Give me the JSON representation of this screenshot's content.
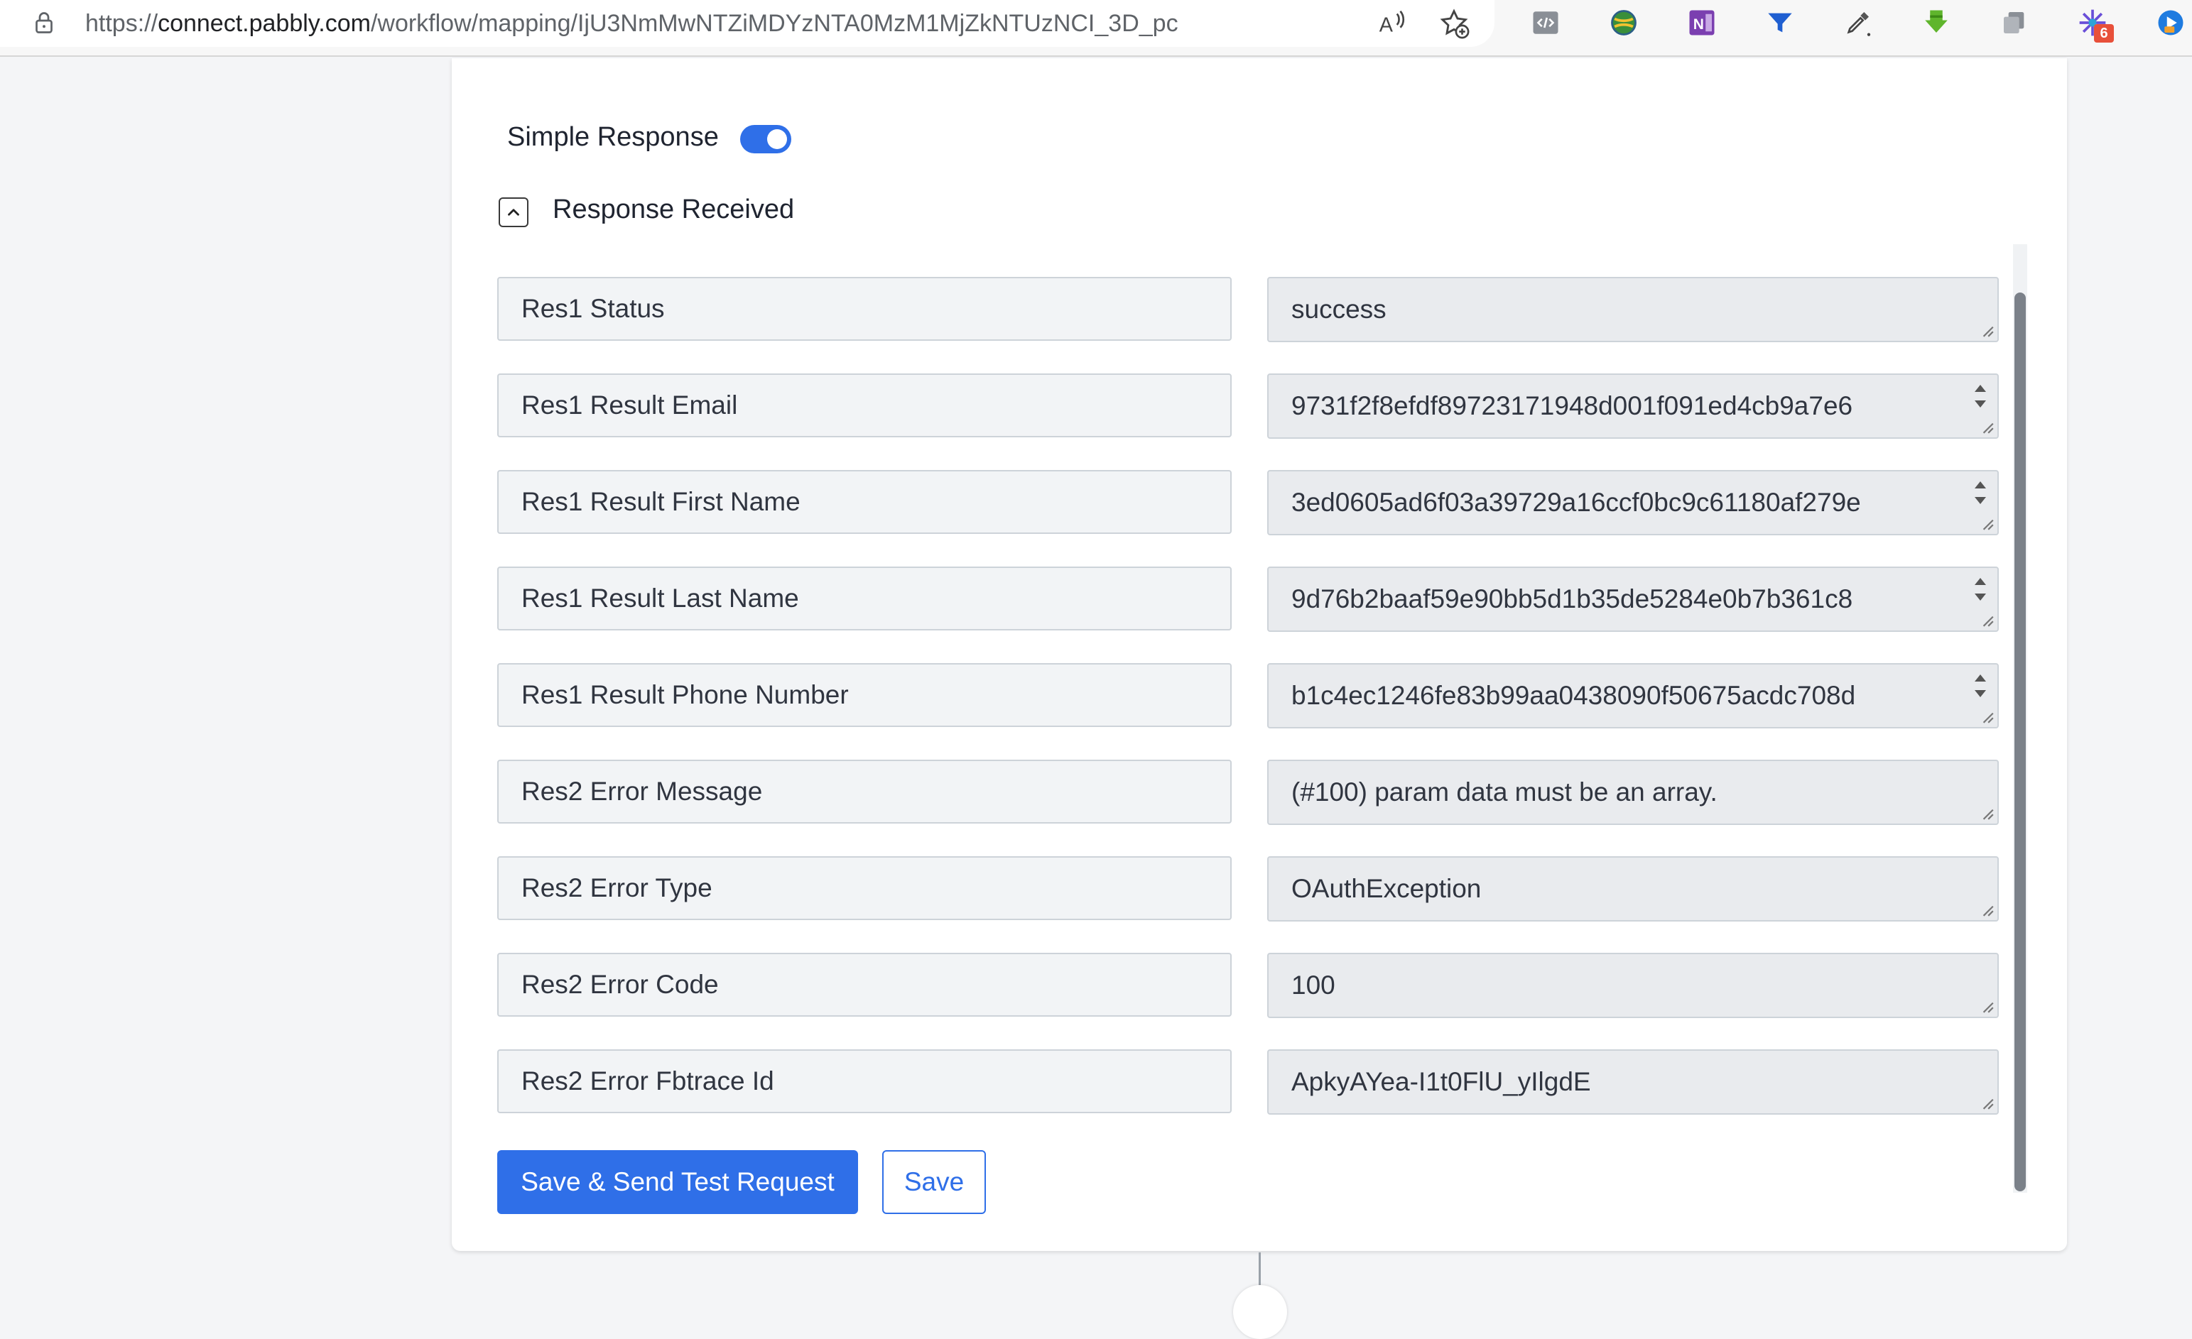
{
  "browser": {
    "url_prefix": "https://",
    "url_host": "connect.pabbly.com",
    "url_path": "/workflow/mapping/IjU3NmMwNTZiMDYzNTA0MzM1MjZkNTUzNCI_3D_pc",
    "extension_badge_count": "6",
    "icons": [
      "lock-icon",
      "read-aloud-icon",
      "add-favorite-icon",
      "dev-tools-icon",
      "globe-extension-icon",
      "onenote-icon",
      "funnel-extension-icon",
      "eyedropper-icon",
      "download-arrow-icon",
      "copy-extension-icon",
      "puzzle-spark-icon",
      "profile-extension-icon"
    ]
  },
  "form": {
    "simple_response_label": "Simple Response",
    "simple_response_on": true,
    "response_received_label": "Response Received",
    "rows": [
      {
        "label": "Res1 Status",
        "value": "success",
        "spinner": false
      },
      {
        "label": "Res1 Result Email",
        "value": "9731f2f8efdf89723171948d001f091ed4cb9a7e6",
        "spinner": true
      },
      {
        "label": "Res1 Result First Name",
        "value": "3ed0605ad6f03a39729a16ccf0bc9c61180af279e",
        "spinner": true
      },
      {
        "label": "Res1 Result Last Name",
        "value": "9d76b2baaf59e90bb5d1b35de5284e0b7b361c8",
        "spinner": true
      },
      {
        "label": "Res1 Result Phone Number",
        "value": "b1c4ec1246fe83b99aa0438090f50675acdc708d",
        "spinner": true
      },
      {
        "label": "Res2 Error Message",
        "value": "(#100) param data must be an array.",
        "spinner": false
      },
      {
        "label": "Res2 Error Type",
        "value": "OAuthException",
        "spinner": false
      },
      {
        "label": "Res2 Error Code",
        "value": "100",
        "spinner": false
      },
      {
        "label": "Res2 Error Fbtrace Id",
        "value": "ApkyAYea-I1t0FlU_yIlgdE",
        "spinner": false
      }
    ],
    "save_send_label": "Save & Send Test Request",
    "save_label": "Save"
  },
  "colors": {
    "primary": "#2f6fe8",
    "field_bg": "#f2f4f6",
    "value_bg": "#e9ebee",
    "border": "#cdd3d9",
    "text": "#303540"
  }
}
